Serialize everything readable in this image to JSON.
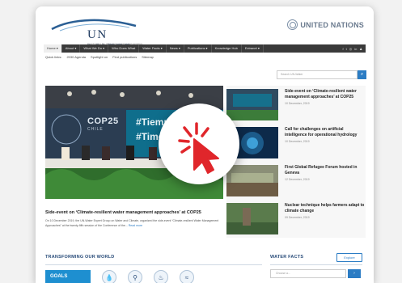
{
  "header": {
    "logo_text": "UN WATER",
    "logo_tagline": "Coordinating the UN's work on water and sanitation",
    "un_text": "UNITED NATIONS"
  },
  "nav": {
    "items": [
      "Home ▾",
      "About ▾",
      "What We Do ▾",
      "Who Does What",
      "Water Facts ▾",
      "News ▾",
      "Publications ▾",
      "Knowledge Hub",
      "Extranet ▾"
    ],
    "social": [
      "f",
      "t",
      "◎",
      "in",
      "♟"
    ]
  },
  "subnav": [
    "Quick links:",
    "2030 Agenda",
    "Spotlight on",
    "Find publications",
    "Sitemap"
  ],
  "search": {
    "placeholder": "Search UN-Water"
  },
  "hero": {
    "title": "Side-event on ‘Climate-resilient water management approaches’ at COP25",
    "description": "On 10 December 2019, the UN-Water Expert Group on Water and Climate, organized the side-event “Climate-resilient Water Management Approaches” at the twenty-fifth session of the Conference of the...",
    "read_more": "Read more",
    "banner_texts": {
      "cop": "COP25",
      "city": "CHILE",
      "hashtag1": "#Tiempo",
      "hashtag2": "#TimeFo"
    }
  },
  "news": [
    {
      "title": "Side-event on ‘Climate-resilient water management approaches’ at COP25",
      "date": "10 December, 2019"
    },
    {
      "title": "Call for challenges on artificial intelligence for operational hydrology",
      "date": "10 December, 2019"
    },
    {
      "title": "First Global Refugee Forum hosted in Geneva",
      "date": "12 December, 2019"
    },
    {
      "title": "Nuclear technique helps farmers adapt to climate change",
      "date": "09 December, 2019"
    }
  ],
  "transforming": {
    "title": "TRANSFORMING OUR WORLD",
    "goals_label": "GOALS",
    "icons": [
      "drop-icon",
      "tap-icon",
      "sanitation-icon",
      "wave-icon"
    ]
  },
  "water_facts": {
    "title": "WATER FACTS",
    "explore_label": "Explore",
    "select_placeholder": "Choose a..."
  },
  "colors": {
    "accent": "#2b7cc4",
    "nav_bg": "#3a3a3a",
    "click_red": "#e0262b",
    "title_blue": "#2a4d7a"
  }
}
